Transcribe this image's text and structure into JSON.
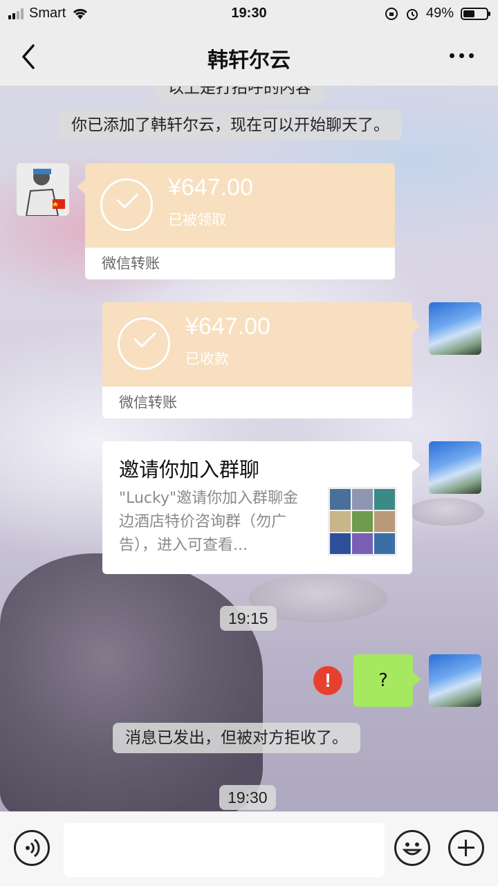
{
  "status_bar": {
    "carrier": "Smart",
    "time": "19:30",
    "battery": "49%",
    "icons": [
      "signal-icon",
      "wifi-icon",
      "orientation-lock-icon",
      "alarm-icon",
      "battery-icon"
    ]
  },
  "nav": {
    "title": "韩轩尔云",
    "back_icon": "chevron-left-icon",
    "more_icon": "more-dots-icon"
  },
  "chat": {
    "system_top_cut": "以上是打招呼的内容",
    "system_added": "你已添加了韩轩尔云，现在可以开始聊天了。",
    "transfer_received_by_friend": {
      "amount": "¥647.00",
      "status": "已被领取",
      "footer": "微信转账"
    },
    "transfer_received_by_me": {
      "amount": "¥647.00",
      "status": "已收款",
      "footer": "微信转账"
    },
    "group_invite": {
      "title": "邀请你加入群聊",
      "description": "\"Lucky\"邀请你加入群聊金边酒店特价咨询群（勿广告），进入可查看..."
    },
    "time_1": "19:15",
    "my_message": "?",
    "error_mark": "!",
    "system_rejected": "消息已发出，但被对方拒收了。",
    "time_2": "19:30"
  },
  "input_bar": {
    "voice_icon": "voice-icon",
    "emoji_icon": "emoji-icon",
    "plus_icon": "plus-icon",
    "placeholder": ""
  },
  "colors": {
    "transfer_orange": "#f7dfbf",
    "my_bubble_green": "#a6e860",
    "error_red": "#e8402f",
    "bar_gray": "#ededed"
  }
}
